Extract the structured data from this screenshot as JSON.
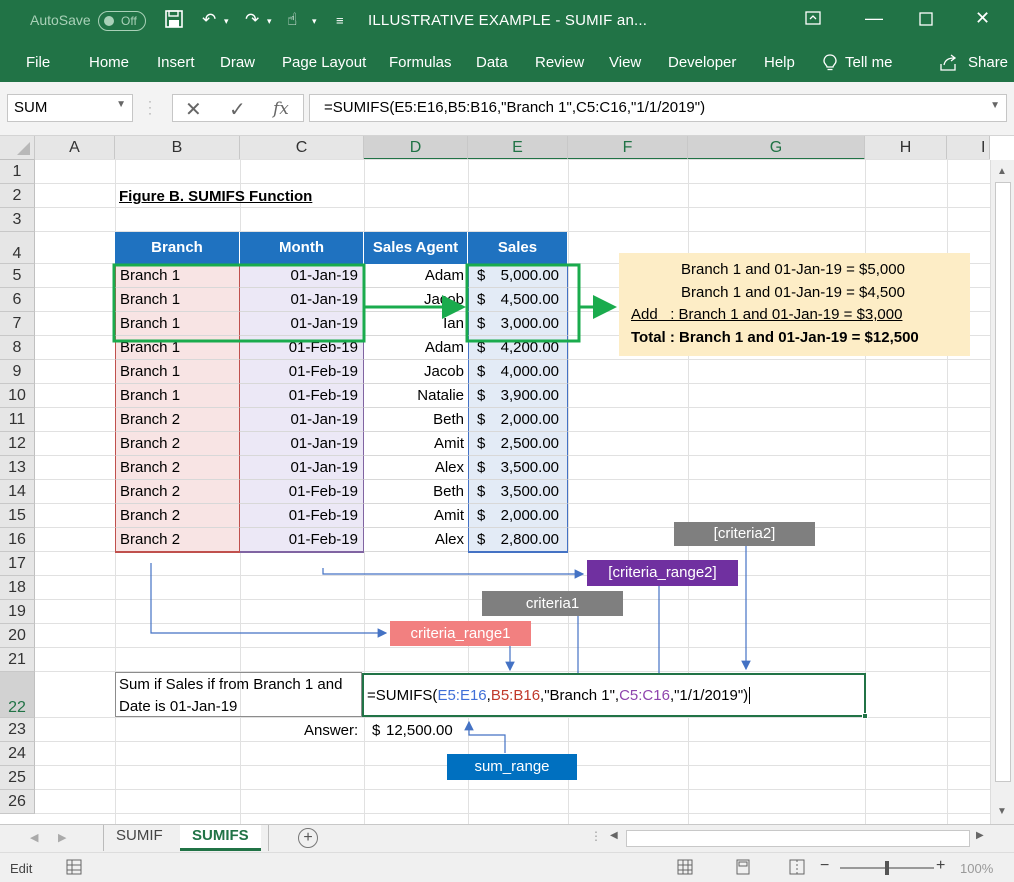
{
  "titlebar": {
    "autosave_label": "AutoSave",
    "autosave_state": "Off",
    "title": "ILLUSTRATIVE EXAMPLE - SUMIF an..."
  },
  "ribbon": {
    "tabs": [
      "File",
      "Home",
      "Insert",
      "Draw",
      "Page Layout",
      "Formulas",
      "Data",
      "Review",
      "View",
      "Developer",
      "Help",
      "Tell me",
      "Share"
    ]
  },
  "formula_bar": {
    "name_box": "SUM",
    "formula": "=SUMIFS(E5:E16,B5:B16,\"Branch 1\",C5:C16,\"1/1/2019\")"
  },
  "columns": [
    "A",
    "B",
    "C",
    "D",
    "E",
    "F",
    "G",
    "H",
    "I"
  ],
  "rows": [
    "1",
    "2",
    "3",
    "4",
    "5",
    "6",
    "7",
    "8",
    "9",
    "10",
    "11",
    "12",
    "13",
    "14",
    "15",
    "16",
    "17",
    "18",
    "19",
    "20",
    "21",
    "22",
    "23",
    "24",
    "25",
    "26"
  ],
  "sheet": {
    "figure_title": "Figure B. SUMIFS Function",
    "table": {
      "headers": [
        "Branch",
        "Month",
        "Sales Agent",
        "Sales"
      ],
      "rows": [
        [
          "Branch 1",
          "01-Jan-19",
          "Adam",
          "$",
          "5,000.00"
        ],
        [
          "Branch 1",
          "01-Jan-19",
          "Jacob",
          "$",
          "4,500.00"
        ],
        [
          "Branch 1",
          "01-Jan-19",
          "Ian",
          "$",
          "3,000.00"
        ],
        [
          "Branch 1",
          "01-Feb-19",
          "Adam",
          "$",
          "4,200.00"
        ],
        [
          "Branch 1",
          "01-Feb-19",
          "Jacob",
          "$",
          "4,000.00"
        ],
        [
          "Branch 1",
          "01-Feb-19",
          "Natalie",
          "$",
          "3,900.00"
        ],
        [
          "Branch 2",
          "01-Jan-19",
          "Beth",
          "$",
          "2,000.00"
        ],
        [
          "Branch 2",
          "01-Jan-19",
          "Amit",
          "$",
          "2,500.00"
        ],
        [
          "Branch 2",
          "01-Jan-19",
          "Alex",
          "$",
          "3,500.00"
        ],
        [
          "Branch 2",
          "01-Feb-19",
          "Beth",
          "$",
          "3,500.00"
        ],
        [
          "Branch 2",
          "01-Feb-19",
          "Amit",
          "$",
          "2,000.00"
        ],
        [
          "Branch 2",
          "01-Feb-19",
          "Alex",
          "$",
          "2,800.00"
        ]
      ]
    },
    "summary_box": {
      "line1": "Branch 1 and 01-Jan-19 = $5,000",
      "line2": "Branch 1 and 01-Jan-19 = $4,500",
      "line3": "Add   : Branch 1 and 01-Jan-19 = $3,000",
      "line4": "Total : Branch 1 and 01-Jan-19 = $12,500"
    },
    "callouts": {
      "criteria2": "[criteria2]",
      "criteria_range2": "[criteria_range2]",
      "criteria1": "criteria1",
      "criteria_range1": "criteria_range1",
      "sum_range": "sum_range"
    },
    "question": {
      "line1": "Sum if Sales if from Branch 1 and",
      "line2": "Date is 01-Jan-19"
    },
    "formula_cell": {
      "p1": "=SUMIFS(",
      "p2": "E5:E16",
      "p3": ",",
      "p4": "B5:B16",
      "p5": ",\"Branch 1\",",
      "p6": "C5:C16",
      "p7": ",\"1/1/2019\")"
    },
    "answer_label": "Answer:",
    "answer_currency": "$",
    "answer_value": "12,500.00"
  },
  "sheet_tabs": [
    "SUMIF",
    "SUMIFS"
  ],
  "status": {
    "mode": "Edit",
    "zoom": "100%"
  },
  "colors": {
    "excel_green": "#217346",
    "table_header": "#1f72c0",
    "branch_fill": "#f8e4e4",
    "month_fill": "#ece8f6",
    "sales_fill": "#e3ebf6",
    "highlight_green": "#1aab4d",
    "summary_fill": "#fdedc6",
    "callout_gray": "#7f7f7f",
    "callout_purple": "#7030a0",
    "callout_red": "#f28080",
    "callout_blue": "#0070c0"
  }
}
